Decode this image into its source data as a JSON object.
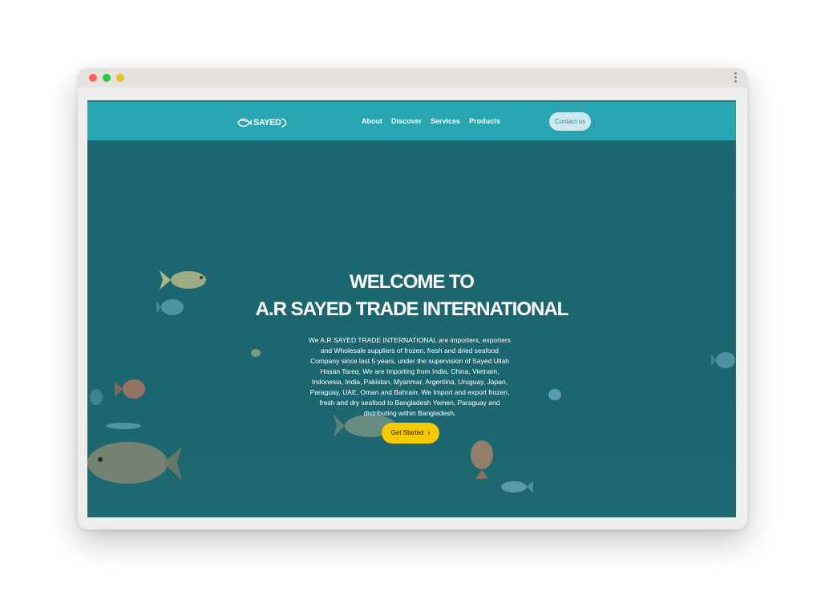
{
  "logo": {
    "text": "SAYED"
  },
  "nav": {
    "links": [
      "About",
      "Discover",
      "Services",
      "Products"
    ],
    "contact_label": "Contact us"
  },
  "hero": {
    "title_line1": "WELCOME TO",
    "title_line2": "A.R SAYED TRADE INTERNATIONAL",
    "description": "We A.R SAYED TRADE INTERNATIONAL are importers, exporters and Wholesale suppliers of frozen, fresh and dried seafood Company since last 5 years, under the supervision of Sayed Ullah Hasan Tareq. We are Importing from India, China, Vietnam, Indonesia, India, Pakistan, Myanmar, Argentina, Uruguay, Japan, Paraguay, UAE, Oman and Bahrain. We Import and export frozen, fresh and dry seafood to Bangladesh Yemen, Paraguay and distributing within Bangladesh.",
    "cta_label": "Get Started",
    "cta_icon": "chevron-right-icon"
  },
  "colors": {
    "navbar": "#29a4b1",
    "hero_bg": "#1b6670",
    "cta": "#f6c800",
    "contact_bg": "#cde9ec"
  }
}
